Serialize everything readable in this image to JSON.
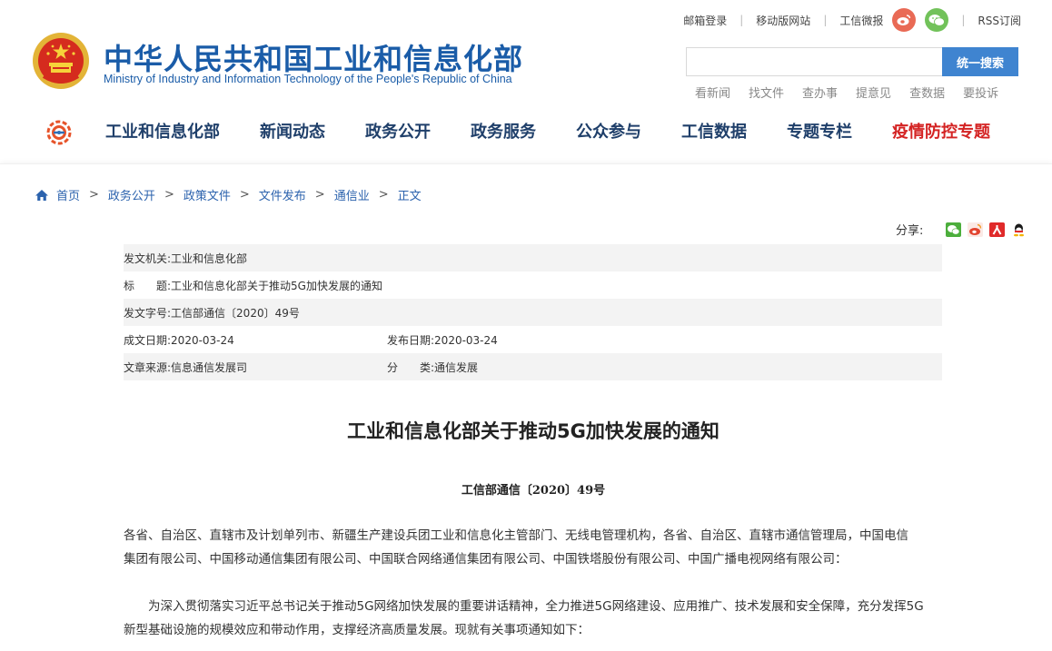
{
  "header": {
    "site_title": "中华人民共和国工业和信息化部",
    "site_subtitle": "Ministry of Industry and Information Technology of the People's Republic of China",
    "top_links": [
      "邮箱登录",
      "移动版网站",
      "工信微报",
      "RSS订阅"
    ],
    "search": {
      "placeholder": "",
      "button_label": "统一搜索"
    },
    "quick_links": [
      "看新闻",
      "找文件",
      "查办事",
      "提意见",
      "查数据",
      "要投诉"
    ],
    "nav": [
      "工业和信息化部",
      "新闻动态",
      "政务公开",
      "政务服务",
      "公众参与",
      "工信数据",
      "专题专栏",
      "疫情防控专题"
    ]
  },
  "breadcrumb": [
    "首页",
    "政务公开",
    "政策文件",
    "文件发布",
    "通信业",
    "正文"
  ],
  "share": {
    "label": "分享:"
  },
  "meta": {
    "issuer_label": "发文机关:",
    "issuer": "工业和信息化部",
    "title_label": "标　　题:",
    "title": "工业和信息化部关于推动5G加快发展的通知",
    "doc_no_label": "发文字号:",
    "doc_no": "工信部通信〔2020〕49号",
    "written_label": "成文日期:",
    "written_date": "2020-03-24",
    "published_label": "发布日期:",
    "published_date": "2020-03-24",
    "source_label": "文章来源:",
    "source": "信息通信发展司",
    "category_label": "分　　类:",
    "category": "通信发展"
  },
  "article": {
    "title": "工业和信息化部关于推动5G加快发展的通知",
    "doc_number": "工信部通信〔2020〕49号",
    "para1_line1": "各省、自治区、直辖市及计划单列市、新疆生产建设兵团工业和信息化主管部门、无线电管理机构，各省、自治区、直辖市通信管理局，中国电信",
    "para1_line2": "集团有限公司、中国移动通信集团有限公司、中国联合网络通信集团有限公司、中国铁塔股份有限公司、中国广播电视网络有限公司：",
    "para2_line1": "　　为深入贯彻落实习近平总书记关于推动5G网络加快发展的重要讲话精神，全力推进5G网络建设、应用推广、技术发展和安全保障，充分发挥5G",
    "para2_line2": "新型基础设施的规模效应和带动作用，支撑经济高质量发展。现就有关事项通知如下："
  },
  "colors": {
    "brand_blue": "#1a5ca8",
    "nav_text": "#1f3f6a",
    "highlight_red": "#d42323",
    "search_button": "#3f84d0"
  }
}
